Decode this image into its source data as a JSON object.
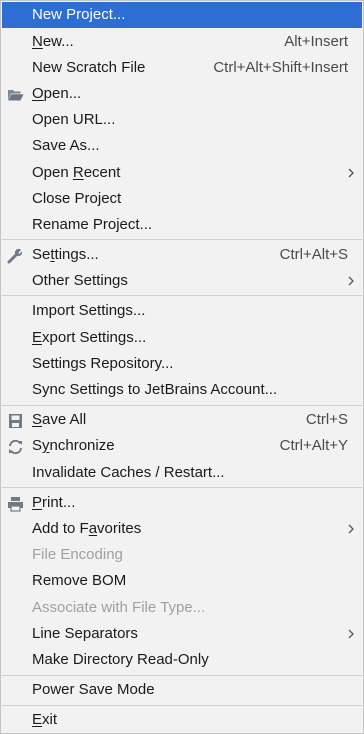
{
  "menu": {
    "new_project": {
      "label": "New Project..."
    },
    "new": {
      "mn": "N",
      "rest": "ew...",
      "shortcut": "Alt+Insert"
    },
    "new_scratch": {
      "label": "New Scratch File",
      "shortcut": "Ctrl+Alt+Shift+Insert"
    },
    "open": {
      "mn": "O",
      "rest": "pen...",
      "icon": "folder-open-icon"
    },
    "open_url": {
      "label": "Open URL..."
    },
    "save_as": {
      "label": "Save As..."
    },
    "open_recent": {
      "pre": "Open ",
      "mn": "R",
      "rest": "ecent"
    },
    "close_project": {
      "label": "Close Project"
    },
    "rename_project": {
      "label": "Rename Project..."
    },
    "settings": {
      "pre": "Se",
      "mn": "t",
      "rest": "tings...",
      "shortcut": "Ctrl+Alt+S",
      "icon": "wrench-icon"
    },
    "other_settings": {
      "label": "Other Settings"
    },
    "import_settings": {
      "label": "Import Settings..."
    },
    "export_settings": {
      "mn": "E",
      "rest": "xport Settings..."
    },
    "settings_repo": {
      "label": "Settings Repository..."
    },
    "sync_settings": {
      "label": "Sync Settings to JetBrains Account..."
    },
    "save_all": {
      "mn": "S",
      "rest": "ave All",
      "shortcut": "Ctrl+S",
      "icon": "save-disk-icon"
    },
    "synchronize": {
      "pre": "S",
      "mn": "y",
      "rest": "nchronize",
      "shortcut": "Ctrl+Alt+Y",
      "icon": "sync-icon"
    },
    "invalidate": {
      "label": "Invalidate Caches / Restart..."
    },
    "print": {
      "mn": "P",
      "rest": "rint...",
      "icon": "printer-icon"
    },
    "add_favorites": {
      "pre": "Add to F",
      "mn": "a",
      "rest": "vorites"
    },
    "file_encoding": {
      "label": "File Encoding"
    },
    "remove_bom": {
      "label": "Remove BOM"
    },
    "associate": {
      "label": "Associate with File Type..."
    },
    "line_separators": {
      "label": "Line Separators"
    },
    "make_readonly": {
      "label": "Make Directory Read-Only"
    },
    "power_save": {
      "label": "Power Save Mode"
    },
    "exit": {
      "mn": "E",
      "rest": "xit"
    }
  },
  "colors": {
    "selected_bg": "#2e6dd3",
    "disabled_text": "#a0a0a0",
    "menu_bg": "#f2f2f2"
  }
}
